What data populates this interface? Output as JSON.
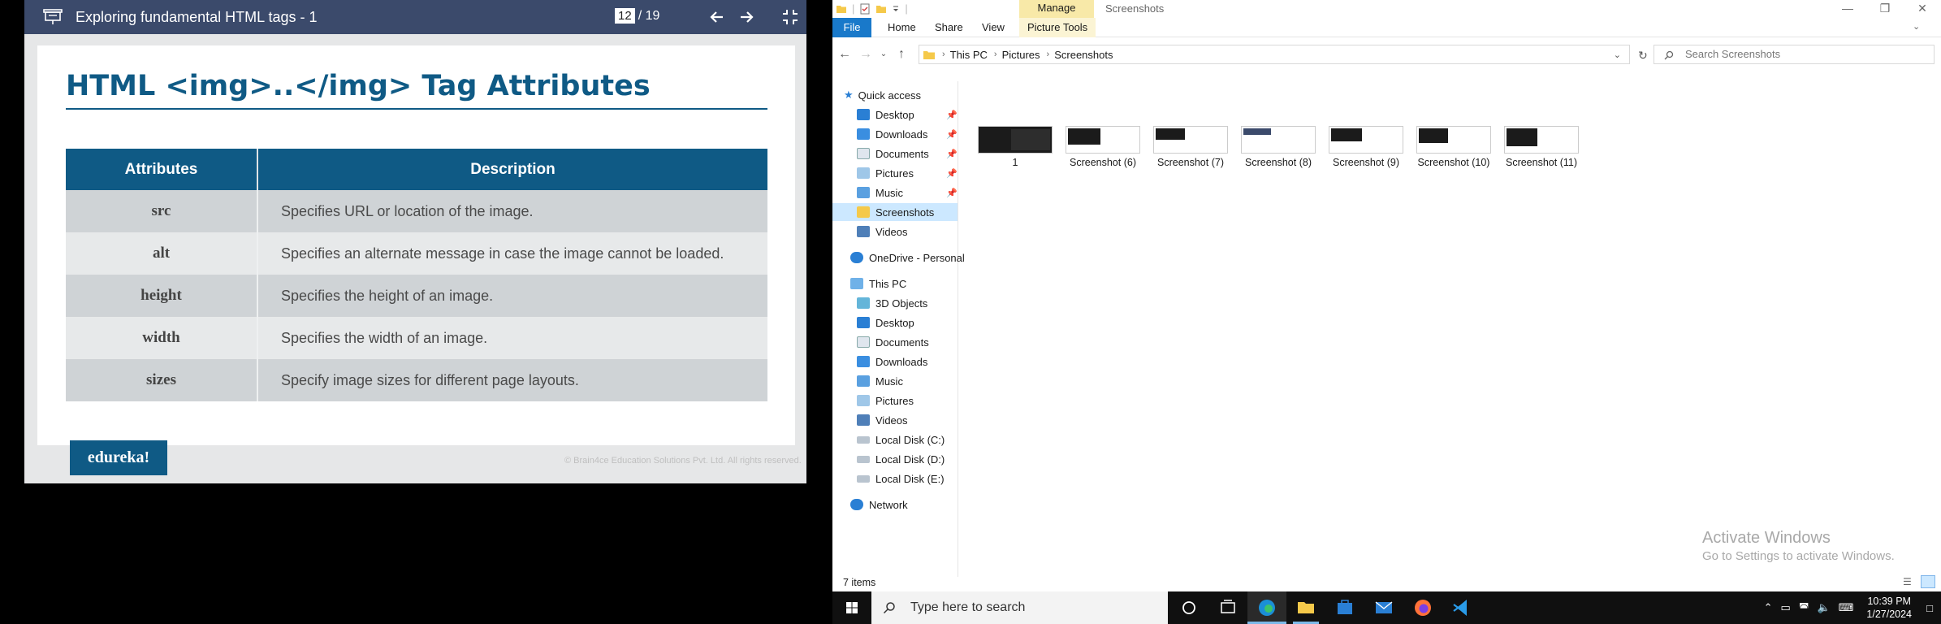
{
  "viewer": {
    "title": "Exploring fundamental HTML tags - 1",
    "page_current": "12",
    "page_total": "/ 19"
  },
  "slide": {
    "title": "HTML <img>..</img> Tag Attributes",
    "table": {
      "headers": [
        "Attributes",
        "Description"
      ],
      "rows": [
        {
          "attr": "src",
          "desc": "Specifies URL or location of the image."
        },
        {
          "attr": "alt",
          "desc": "Specifies an alternate message in case the image cannot be loaded."
        },
        {
          "attr": "height",
          "desc": "Specifies the height of an image."
        },
        {
          "attr": "width",
          "desc": "Specifies the width of an image."
        },
        {
          "attr": "sizes",
          "desc": "Specify image sizes for different page layouts."
        }
      ]
    },
    "logo": "edureka!",
    "copyright": "© Brain4ce Education Solutions Pvt. Ltd. All rights reserved."
  },
  "explorer": {
    "manage_label": "Manage",
    "window_title": "Screenshots",
    "ribbon_tabs": [
      "File",
      "Home",
      "Share",
      "View",
      "Picture Tools"
    ],
    "breadcrumb": [
      "This PC",
      "Pictures",
      "Screenshots"
    ],
    "search_placeholder": "Search Screenshots",
    "nav": {
      "quick_access": "Quick access",
      "quick_items": [
        "Desktop",
        "Downloads",
        "Documents",
        "Pictures",
        "Music",
        "Screenshots",
        "Videos"
      ],
      "onedrive": "OneDrive - Personal",
      "this_pc": "This PC",
      "pc_items": [
        "3D Objects",
        "Desktop",
        "Documents",
        "Downloads",
        "Music",
        "Pictures",
        "Videos",
        "Local Disk (C:)",
        "Local Disk (D:)",
        "Local Disk (E:)"
      ],
      "network": "Network"
    },
    "files": [
      "1",
      "Screenshot (6)",
      "Screenshot (7)",
      "Screenshot (8)",
      "Screenshot (9)",
      "Screenshot (10)",
      "Screenshot (11)"
    ],
    "status": "7 items",
    "watermark_title": "Activate Windows",
    "watermark_sub": "Go to Settings to activate Windows."
  },
  "taskbar": {
    "search_placeholder": "Type here to search",
    "time": "10:39 PM",
    "date": "1/27/2024"
  }
}
